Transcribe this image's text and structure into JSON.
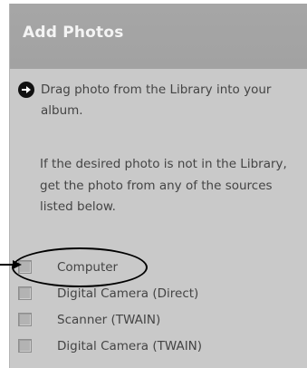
{
  "panel": {
    "title": "Add Photos"
  },
  "instruction": {
    "icon": "arrow-right-circle-icon",
    "text": "Drag photo from the Library into your album."
  },
  "note": {
    "text": "If the desired photo is not in the Library, get the photo from any of the sources listed below."
  },
  "sources": [
    {
      "label": "Computer",
      "checked": false
    },
    {
      "label": "Digital Camera (Direct)",
      "checked": false
    },
    {
      "label": "Scanner (TWAIN)",
      "checked": false
    },
    {
      "label": "Digital Camera (TWAIN)",
      "checked": false
    }
  ],
  "annotation": {
    "highlighted_item": "Computer",
    "color": "#000000"
  }
}
